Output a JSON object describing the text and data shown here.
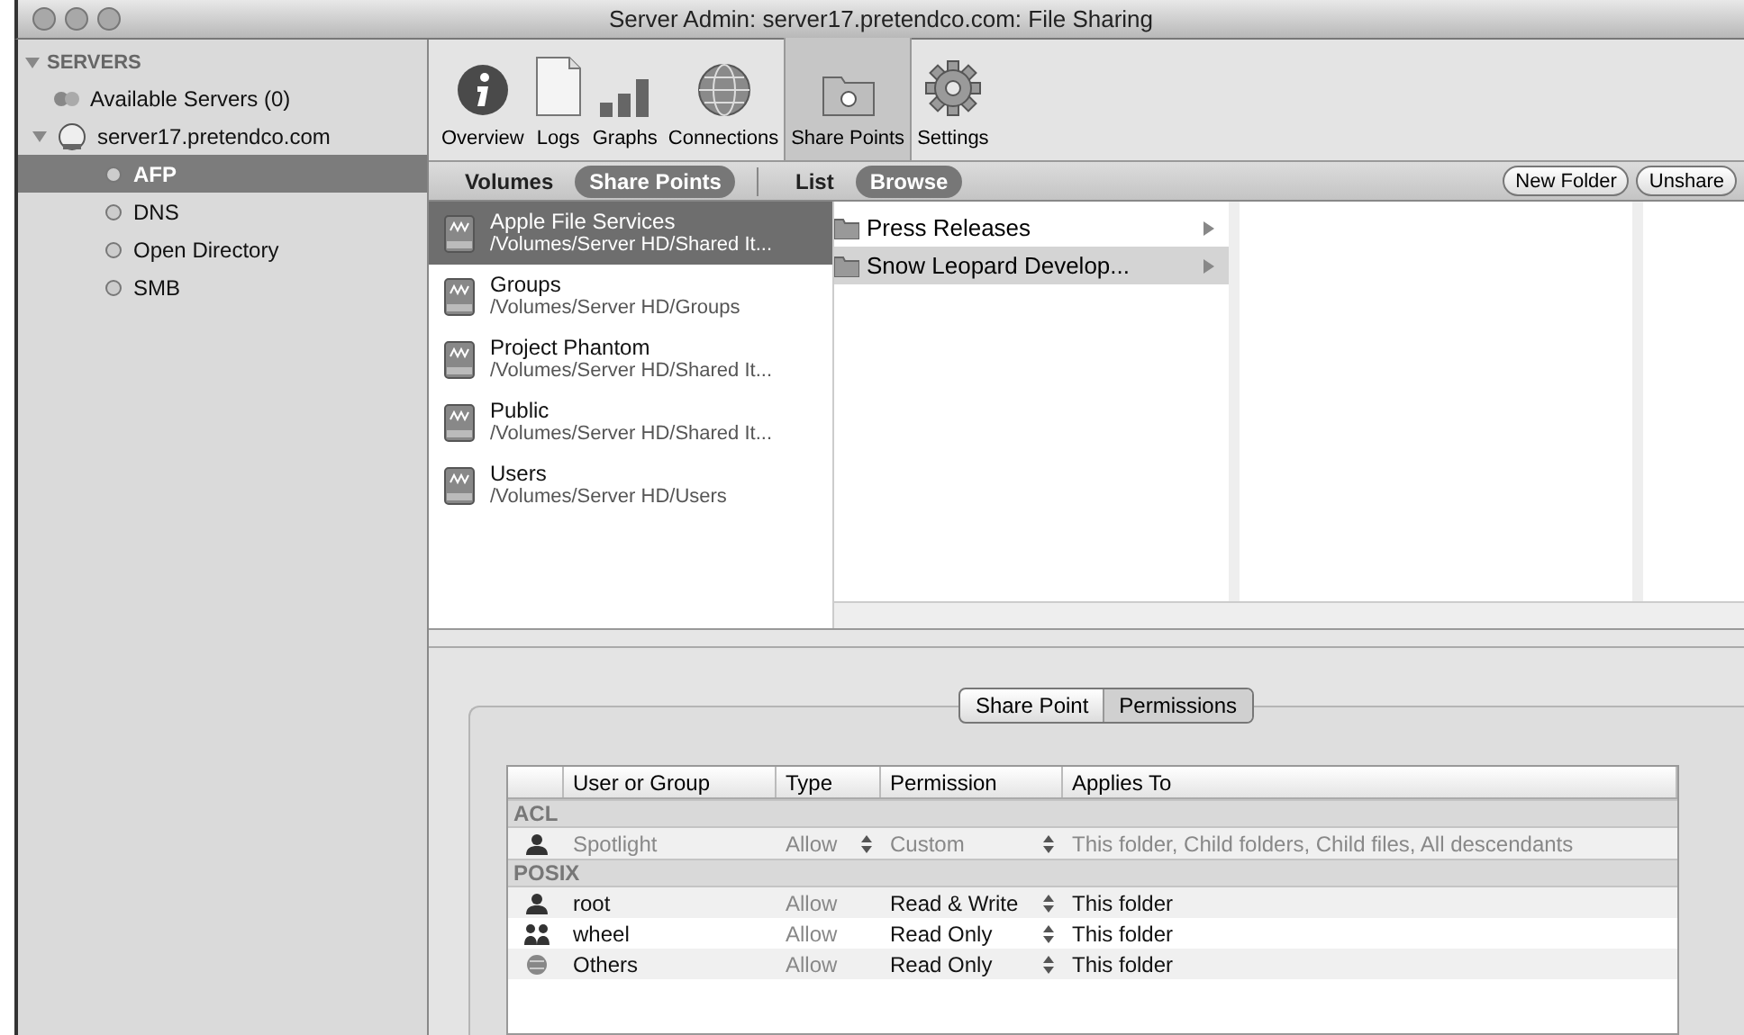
{
  "window": {
    "title": "Server Admin: server17.pretendco.com: File Sharing"
  },
  "sidebar": {
    "header": {
      "label": "SERVERS",
      "expanded": true
    },
    "items": [
      {
        "label": "Available Servers (0)",
        "kind": "network",
        "selected": false
      },
      {
        "label": "server17.pretendco.com",
        "kind": "server",
        "selected": false,
        "expanded": true,
        "children": [
          {
            "label": "AFP",
            "kind": "service",
            "selected": true
          },
          {
            "label": "DNS",
            "kind": "service",
            "selected": false
          },
          {
            "label": "Open Directory",
            "kind": "service",
            "selected": false
          },
          {
            "label": "SMB",
            "kind": "service",
            "selected": false
          }
        ]
      }
    ]
  },
  "toolbar": [
    {
      "label": "Overview",
      "kind": "info",
      "selected": false
    },
    {
      "label": "Logs",
      "kind": "document",
      "selected": false
    },
    {
      "label": "Graphs",
      "kind": "graph",
      "selected": false
    },
    {
      "label": "Connections",
      "kind": "globe",
      "selected": false
    },
    {
      "label": "Share Points",
      "kind": "share",
      "selected": true
    },
    {
      "label": "Settings",
      "kind": "gear",
      "selected": false
    }
  ],
  "scope_tabs": [
    {
      "label": "Volumes",
      "selected": false
    },
    {
      "label": "Share Points",
      "selected": true
    }
  ],
  "view_tabs": [
    {
      "label": "List",
      "selected": false
    },
    {
      "label": "Browse",
      "selected": true
    }
  ],
  "buttons": [
    "New Folder",
    "Unshare"
  ],
  "share_points": [
    {
      "name": "Apple File Services",
      "path": "/Volumes/Server HD/Shared It...",
      "selected": true
    },
    {
      "name": "Groups",
      "path": "/Volumes/Server HD/Groups",
      "selected": false
    },
    {
      "name": "Project Phantom",
      "path": "/Volumes/Server HD/Shared It...",
      "selected": false
    },
    {
      "name": "Public",
      "path": "/Volumes/Server HD/Shared It...",
      "selected": false
    },
    {
      "name": "Users",
      "path": "/Volumes/Server HD/Users",
      "selected": false
    }
  ],
  "folders": [
    {
      "name": "Press Releases",
      "selected": false
    },
    {
      "name": "Snow Leopard Develop...",
      "selected": true
    }
  ],
  "detail_tabs": [
    {
      "label": "Share Point",
      "selected": false
    },
    {
      "label": "Permissions",
      "selected": true
    }
  ],
  "table": {
    "columns": [
      "User or Group",
      "Type",
      "Permission",
      "Applies To"
    ],
    "groups": [
      {
        "name": "ACL",
        "rows": [
          {
            "kind": "user",
            "name": "Spotlight",
            "type": "Allow",
            "permission": "Custom",
            "applies_to": "This folder, Child folders, Child files, All descendants",
            "disabled": true
          }
        ]
      },
      {
        "name": "POSIX",
        "rows": [
          {
            "kind": "user",
            "name": "root",
            "type": "Allow",
            "permission": "Read & Write",
            "applies_to": "This folder",
            "disabled": false
          },
          {
            "kind": "group",
            "name": "wheel",
            "type": "Allow",
            "permission": "Read Only",
            "applies_to": "This folder",
            "disabled": false
          },
          {
            "kind": "everyone",
            "name": "Others",
            "type": "Allow",
            "permission": "Read Only",
            "applies_to": "This folder",
            "disabled": false
          }
        ]
      }
    ]
  }
}
